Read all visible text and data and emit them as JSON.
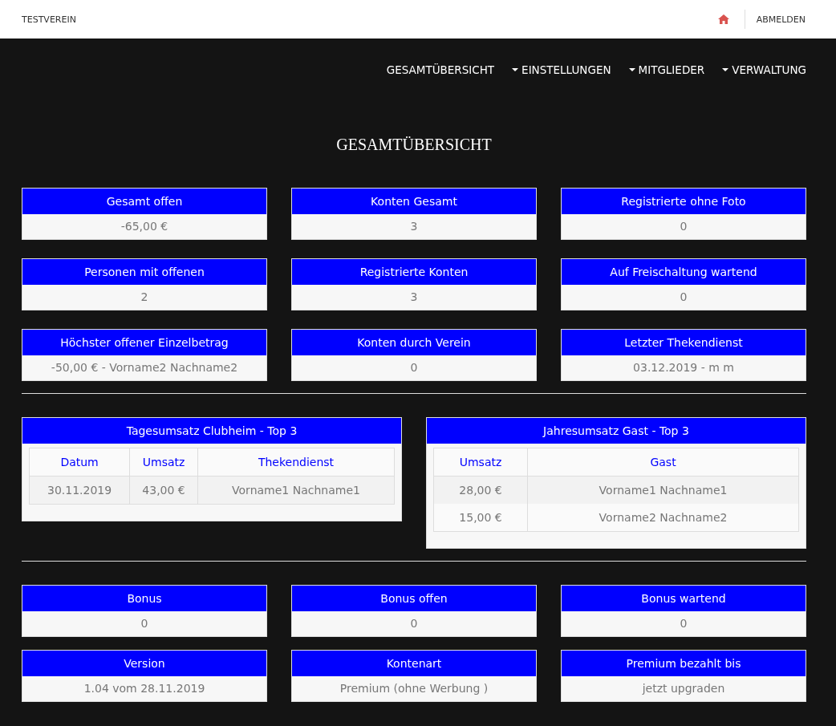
{
  "top_bar": {
    "brand": "TESTVEREIN",
    "logout": "ABMELDEN"
  },
  "nav": [
    {
      "label": "GESAMTÜBERSICHT",
      "dropdown": false
    },
    {
      "label": "EINSTELLUNGEN",
      "dropdown": true
    },
    {
      "label": "MITGLIEDER",
      "dropdown": true
    },
    {
      "label": "VERWALTUNG",
      "dropdown": true
    }
  ],
  "title": "GESAMTÜBERSICHT",
  "stats": [
    {
      "title": "Gesamt offen",
      "value": "-65,00 €"
    },
    {
      "title": "Konten Gesamt",
      "value": "3"
    },
    {
      "title": "Registrierte ohne Foto",
      "value": "0"
    },
    {
      "title": "Personen mit offenen",
      "value": "2"
    },
    {
      "title": "Registrierte Konten",
      "value": "3"
    },
    {
      "title": "Auf Freischaltung wartend",
      "value": "0"
    },
    {
      "title": "Höchster offener Einzelbetrag",
      "value": "-50,00 € - Vorname2 Nachname2"
    },
    {
      "title": "Konten durch Verein",
      "value": "0"
    },
    {
      "title": "Letzter Thekendienst",
      "value": "03.12.2019 - m m"
    }
  ],
  "tables": [
    {
      "title": "Tagesumsatz Clubheim - Top 3",
      "columns": [
        "Datum",
        "Umsatz",
        "Thekendienst"
      ],
      "rows": [
        [
          "30.11.2019",
          "43,00 €",
          "Vorname1 Nachname1"
        ]
      ]
    },
    {
      "title": "Jahresumsatz Gast - Top 3",
      "columns": [
        "Umsatz",
        "Gast"
      ],
      "rows": [
        [
          "28,00 €",
          "Vorname1 Nachname1"
        ],
        [
          "15,00 €",
          "Vorname2 Nachname2"
        ]
      ]
    }
  ],
  "bonus_stats": [
    {
      "title": "Bonus",
      "value": "0"
    },
    {
      "title": "Bonus offen",
      "value": "0"
    },
    {
      "title": "Bonus wartend",
      "value": "0"
    },
    {
      "title": "Version",
      "value": "1.04 vom 28.11.2019"
    },
    {
      "title": "Kontenart",
      "value": "Premium (ohne Werbung )"
    },
    {
      "title": "Premium bezahlt bis",
      "value": "jetzt upgraden"
    }
  ]
}
